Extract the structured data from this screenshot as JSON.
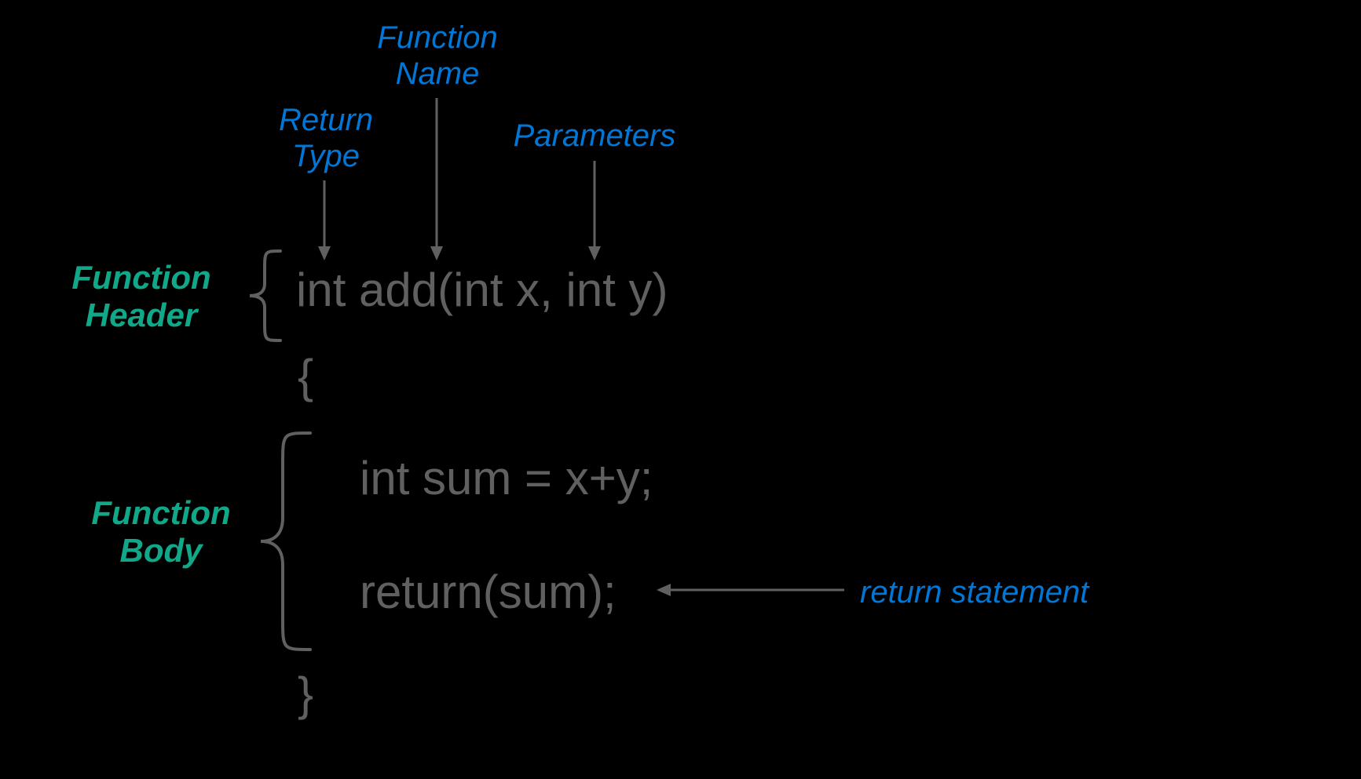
{
  "labels": {
    "function_name": "Function\nName",
    "return_type": "Return\nType",
    "parameters": "Parameters",
    "function_header": "Function\nHeader",
    "function_body": "Function\nBody",
    "return_stmt": "return statement"
  },
  "code": {
    "line1": "int add(int x, int y)",
    "line2": "{",
    "line3": "int sum = x+y;",
    "line4": "return(sum);",
    "line5": "}"
  }
}
